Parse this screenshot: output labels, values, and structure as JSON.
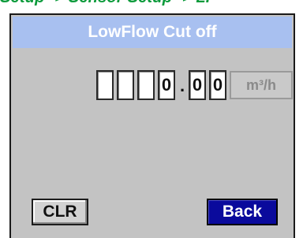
{
  "breadcrumb": {
    "text": "Setup -> Sensor Setup -> LF"
  },
  "dialog": {
    "title": "LowFlow Cut off"
  },
  "value_input": {
    "digits": [
      "",
      "",
      "",
      "0",
      "0",
      "0"
    ],
    "decimal_separator": ".",
    "unit": "m³/h"
  },
  "buttons": {
    "clr_label": "CLR",
    "back_label": "Back"
  },
  "colors": {
    "breadcrumb": "#0a9a3a",
    "title_bar": "#a8c0f0",
    "panel": "#c3c3c3",
    "back_button": "#0a0a9c"
  }
}
